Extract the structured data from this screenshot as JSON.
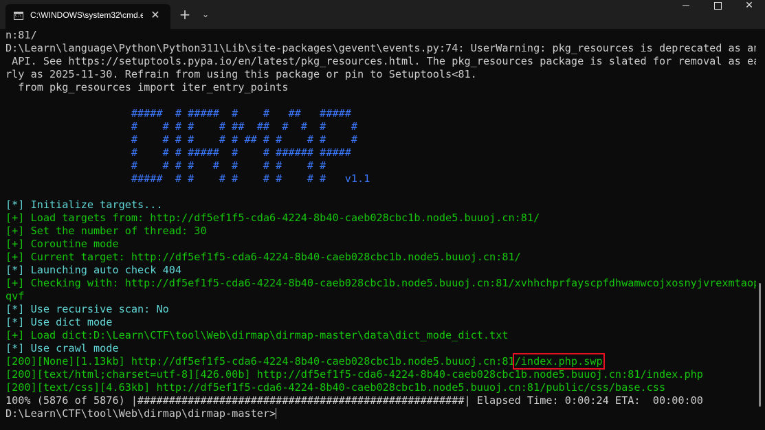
{
  "window": {
    "tab_title": "C:\\WINDOWS\\system32\\cmd.e",
    "tab_close": "✕",
    "new_tab": "+",
    "dropdown": "⌄",
    "close": "✕"
  },
  "console": {
    "lines": [
      {
        "color": "white",
        "text": "n:81/"
      },
      {
        "color": "white",
        "text": "D:\\Learn\\language\\Python\\Python311\\Lib\\site-packages\\gevent\\events.py:74: UserWarning: pkg_resources is deprecated as an"
      },
      {
        "color": "white",
        "text": " API. See https://setuptools.pypa.io/en/latest/pkg_resources.html. The pkg_resources package is slated for removal as ea"
      },
      {
        "color": "white",
        "text": "rly as 2025-11-30. Refrain from using this package or pin to Setuptools<81."
      },
      {
        "color": "white",
        "text": "  from pkg_resources import iter_entry_points"
      },
      {
        "color": "white",
        "text": ""
      },
      {
        "color": "blue",
        "text": "                    #####  # #####  #    #   ##   #####"
      },
      {
        "color": "blue",
        "text": "                    #    # # #    # ##  ##  #  #  #    #"
      },
      {
        "color": "blue",
        "text": "                    #    # # #    # # ## # #    # #    #"
      },
      {
        "color": "blue",
        "text": "                    #    # # #####  #    # ###### #####"
      },
      {
        "color": "blue",
        "text": "                    #    # # #   #  #    # #    # #"
      },
      {
        "color": "blue",
        "text": "                    #####  # #    # #    # #    # #   v1.1"
      },
      {
        "color": "white",
        "text": ""
      },
      {
        "color": "cyan",
        "text": "[*] Initialize targets..."
      },
      {
        "color": "green",
        "text": "[+] Load targets from: http://df5ef1f5-cda6-4224-8b40-caeb028cbc1b.node5.buuoj.cn:81/"
      },
      {
        "color": "green",
        "text": "[+] Set the number of thread: 30"
      },
      {
        "color": "green",
        "text": "[+] Coroutine mode"
      },
      {
        "color": "green",
        "text": "[+] Current target: http://df5ef1f5-cda6-4224-8b40-caeb028cbc1b.node5.buuoj.cn:81/"
      },
      {
        "color": "cyan",
        "text": "[*] Launching auto check 404"
      },
      {
        "color": "green",
        "text": "[+] Checking with: http://df5ef1f5-cda6-4224-8b40-caeb028cbc1b.node5.buuoj.cn:81/xvhhchprfayscpfdhwamwcojxosnyjvrexmtaop"
      },
      {
        "color": "green",
        "text": "qvf"
      },
      {
        "color": "cyan",
        "text": "[*] Use recursive scan: No"
      },
      {
        "color": "cyan",
        "text": "[*] Use dict mode"
      },
      {
        "color": "green",
        "text": "[+] Load dict:D:\\Learn\\CTF\\tool\\Web\\dirmap\\dirmap-master\\data\\dict_mode_dict.txt"
      },
      {
        "color": "cyan",
        "text": "[*] Use crawl mode"
      },
      {
        "color": "green",
        "text": "[200][None][1.13kb] http://df5ef1f5-cda6-4224-8b40-caeb028cbc1b.node5.buuoj.cn:81",
        "highlight": "/index.php.swp"
      },
      {
        "color": "green",
        "text": "[200][text/html;charset=utf-8][426.00b] http://df5ef1f5-cda6-4224-8b40-caeb028cbc1b.node5.buuoj.cn:81/index.php"
      },
      {
        "color": "green",
        "text": "[200][text/css][4.63kb] http://df5ef1f5-cda6-4224-8b40-caeb028cbc1b.node5.buuoj.cn:81/public/css/base.css"
      },
      {
        "color": "white",
        "text": "100% (5876 of 5876) |####################################################| Elapsed Time: 0:00:24 ETA:  00:00:00"
      },
      {
        "color": "white",
        "text": "D:\\Learn\\CTF\\tool\\Web\\dirmap\\dirmap-master>",
        "cursor": true
      }
    ]
  }
}
